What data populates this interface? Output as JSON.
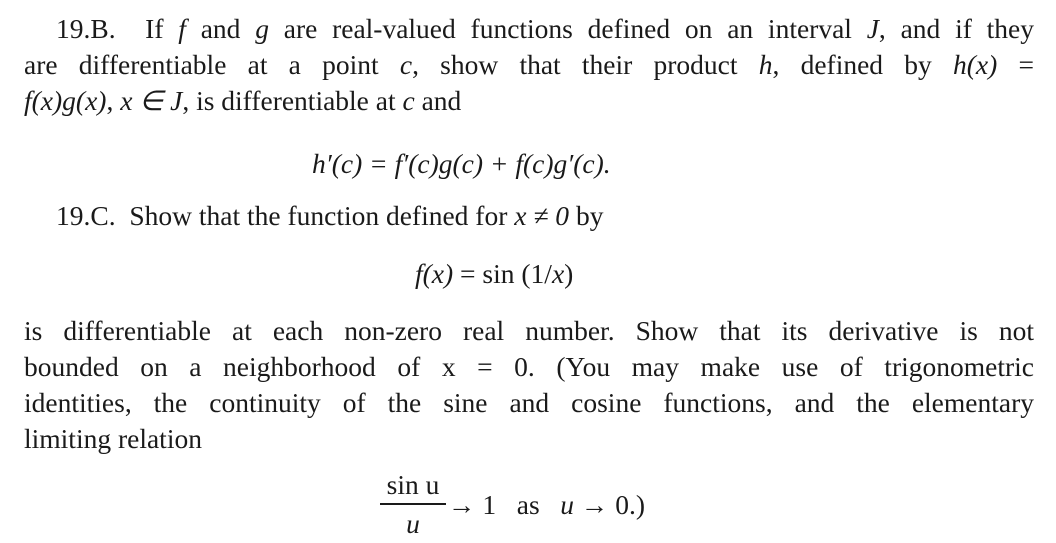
{
  "problem_19B": {
    "label": "19.B.",
    "line1": {
      "p1": "If ",
      "f": "f",
      "p2": " and ",
      "g": "g",
      "p3": " are real-valued functions defined on an interval ",
      "J": "J",
      "p4": ", and if they"
    },
    "line2": {
      "p1": "are differentiable at a point ",
      "c": "c",
      "p2": ", show that their product ",
      "h": "h",
      "p3": ", defined by ",
      "hx": "h(x)",
      "p4": " ="
    },
    "line3": {
      "fxgx": "f(x)g(x)",
      "p1": ", ",
      "xinJ": "x ∈ J",
      "p2": ", is differentiable at ",
      "c": "c",
      "p3": " and"
    },
    "equation": "h′(c) = f′(c)g(c) + f(c)g′(c)."
  },
  "problem_19C": {
    "label": "19.C.",
    "line1": {
      "p1": "Show that the function defined for ",
      "cond": "x ≠ 0",
      "p2": " by"
    },
    "equation": {
      "lhs": "f(x)",
      "rhs": " = sin (1/",
      "x": "x",
      "close": ")"
    },
    "para_lines": [
      "is differentiable at each non-zero real number. Show that its derivative is not",
      "bounded on a neighborhood of x = 0. (You may make use of trigonometric",
      "identities, the continuity of the sine and cosine functions, and the elementary",
      "limiting relation"
    ],
    "limit": {
      "numerator": "sin u",
      "denominator": "u",
      "arrow1": "→ 1",
      "as": "as",
      "u": "u",
      "arrow2": "→ 0.)"
    }
  }
}
